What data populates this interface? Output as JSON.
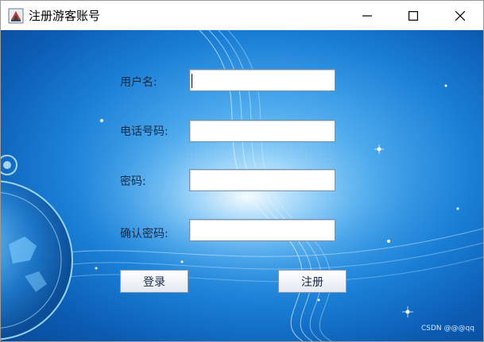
{
  "window": {
    "title": "注册游客账号"
  },
  "form": {
    "username_label": "用户名:",
    "phone_label": "电话号码:",
    "password_label": "密码:",
    "confirm_label": "确认密码:",
    "username_value": "",
    "phone_value": "",
    "password_value": "",
    "confirm_value": ""
  },
  "buttons": {
    "login_label": "登录",
    "register_label": "注册"
  },
  "watermark": "CSDN @@@qq",
  "icons": {
    "app": "java-cup-icon",
    "minimize": "minimize-icon",
    "maximize": "maximize-icon",
    "close": "close-icon"
  },
  "colors": {
    "background_blue": "#1a7fd6",
    "label_text": "#1a2a44"
  }
}
